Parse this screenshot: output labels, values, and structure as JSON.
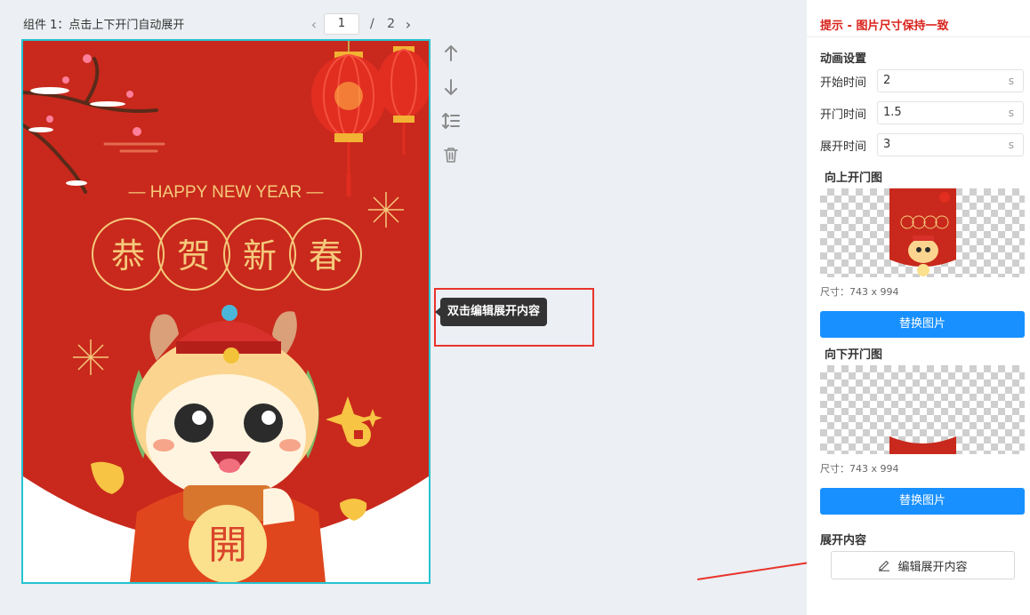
{
  "canvas": {
    "component_title": "组件 1：点击上下开门自动展开",
    "pagination": {
      "current": "1",
      "separator": "/",
      "total": "2"
    },
    "poster": {
      "headline": "— HAPPY NEW YEAR —",
      "greeting_chars": [
        "恭",
        "贺",
        "新",
        "春"
      ],
      "open_char": "開",
      "colors": {
        "bg": "#c8291c",
        "gold": "#f5c97b",
        "white": "#ffffff"
      }
    },
    "tools": [
      {
        "name": "move-up-icon"
      },
      {
        "name": "move-down-icon"
      },
      {
        "name": "reorder-icon"
      },
      {
        "name": "delete-icon"
      }
    ],
    "tooltip": "双击编辑展开内容"
  },
  "panel": {
    "tip": "提示 - 图片尺寸保持一致",
    "anim_title": "动画设置",
    "fields": [
      {
        "label": "开始时间",
        "value": "2",
        "unit": "s"
      },
      {
        "label": "开门时间",
        "value": "1.5",
        "unit": "s"
      },
      {
        "label": "展开时间",
        "value": "3",
        "unit": "s"
      }
    ],
    "up_image": {
      "title": "向上开门图",
      "size": "尺寸：743 x 994",
      "button": "替换图片"
    },
    "down_image": {
      "title": "向下开门图",
      "size": "尺寸：743 x 994",
      "button": "替换图片"
    },
    "expand_title": "展开内容",
    "edit_button": "编辑展开内容",
    "accent": "#1890ff",
    "tip_color": "#d9231c"
  }
}
